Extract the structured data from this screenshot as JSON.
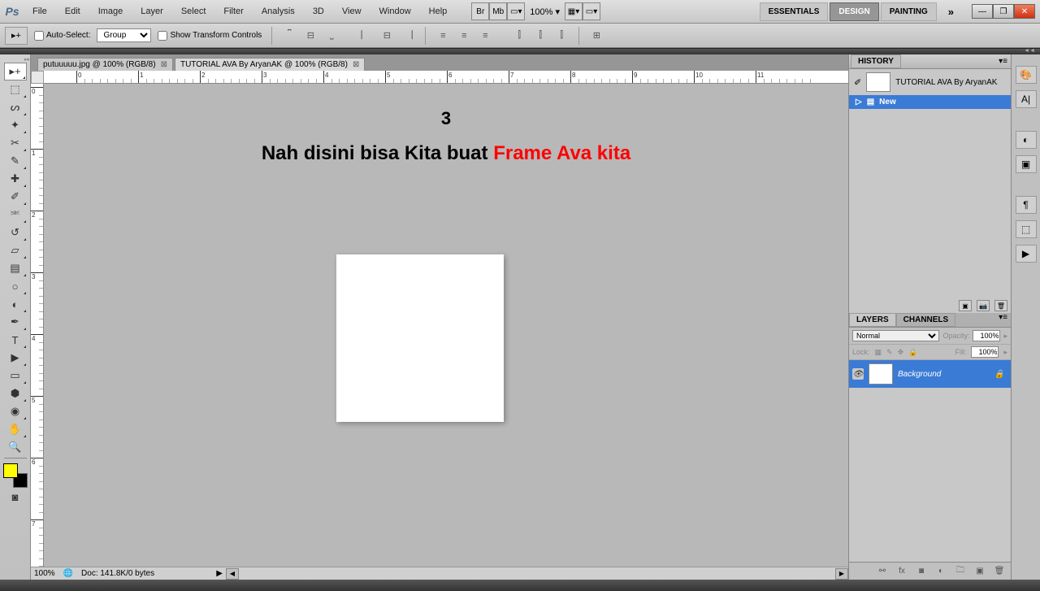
{
  "app": {
    "logo": "Ps"
  },
  "menu": [
    "File",
    "Edit",
    "Image",
    "Layer",
    "Select",
    "Filter",
    "Analysis",
    "3D",
    "View",
    "Window",
    "Help"
  ],
  "menubar_right": {
    "zoom": "100%",
    "br": "Br",
    "mb": "Mb"
  },
  "workspaces": {
    "essentials": "ESSENTIALS",
    "design": "DESIGN",
    "painting": "PAINTING"
  },
  "options": {
    "auto_select": "Auto-Select:",
    "group": "Group",
    "show_transform": "Show Transform Controls"
  },
  "tabs": [
    {
      "label": "putuuuuu.jpg @ 100% (RGB/8)"
    },
    {
      "label": "TUTORIAL AVA By AryanAK @ 100% (RGB/8)"
    }
  ],
  "annotation": {
    "number": "3",
    "text_black": "Nah disini bisa Kita buat ",
    "text_red": "Frame Ava kita"
  },
  "history": {
    "title": "HISTORY",
    "doc_name": "TUTORIAL AVA By AryanAK",
    "state": "New"
  },
  "layers": {
    "tab_layers": "LAYERS",
    "tab_channels": "CHANNELS",
    "blend": "Normal",
    "opacity_label": "Opacity:",
    "opacity_val": "100%",
    "lock_label": "Lock:",
    "fill_label": "Fill:",
    "fill_val": "100%",
    "bg_name": "Background"
  },
  "status": {
    "zoom": "100%",
    "doc": "Doc: 141.8K/0 bytes"
  },
  "ruler_labels": [
    "0",
    "1",
    "2",
    "3",
    "4",
    "5",
    "6",
    "7",
    "8",
    "9",
    "10",
    "11"
  ],
  "ruler_v_labels": [
    "0",
    "1",
    "2",
    "3",
    "4",
    "5",
    "6",
    "7"
  ],
  "colors": {
    "fg": "#ffff00",
    "bg": "#000000",
    "accent": "#3a7bd5"
  }
}
